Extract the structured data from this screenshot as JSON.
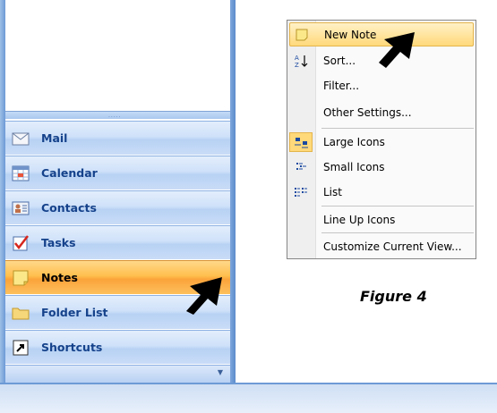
{
  "nav": {
    "grip": ".....",
    "items": [
      {
        "label": "Mail",
        "icon": "envelope-icon"
      },
      {
        "label": "Calendar",
        "icon": "calendar-icon"
      },
      {
        "label": "Contacts",
        "icon": "contact-card-icon"
      },
      {
        "label": "Tasks",
        "icon": "task-check-icon"
      },
      {
        "label": "Notes",
        "icon": "sticky-note-icon",
        "active": true
      },
      {
        "label": "Folder List",
        "icon": "folder-icon"
      },
      {
        "label": "Shortcuts",
        "icon": "shortcut-arrow-icon"
      }
    ],
    "footer_icon": "chevron-down-icon"
  },
  "context_menu": {
    "items": [
      {
        "label": "New Note",
        "icon": "new-note-icon",
        "highlighted": true
      },
      {
        "label": "Sort...",
        "icon": "sort-az-icon"
      },
      {
        "label": "Filter...",
        "icon": ""
      },
      {
        "label": "Other Settings...",
        "icon": ""
      },
      {
        "label": "Large Icons",
        "icon": "large-icons-icon"
      },
      {
        "label": "Small Icons",
        "icon": "small-icons-icon"
      },
      {
        "label": "List",
        "icon": "list-view-icon"
      },
      {
        "label": "Line Up Icons",
        "icon": ""
      },
      {
        "label": "Customize Current View...",
        "icon": ""
      }
    ]
  },
  "caption": "Figure 4",
  "colors": {
    "nav_blue": "#c9dcf7",
    "nav_active": "#fba33a",
    "label_blue": "#15428b",
    "menu_highlight": "#ffd97a"
  }
}
